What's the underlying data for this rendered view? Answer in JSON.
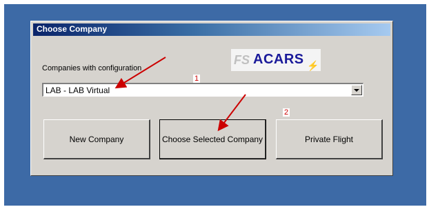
{
  "window": {
    "title": "Choose Company"
  },
  "form": {
    "companies_label": "Companies with configuration",
    "selected_company": "LAB - LAB Virtual"
  },
  "logo": {
    "prefix": "FS",
    "name": "ACARS"
  },
  "buttons": {
    "new_company": "New Company",
    "choose_selected": "Choose Selected Company",
    "private_flight": "Private Flight"
  },
  "annotations": {
    "marker1": "1",
    "marker2": "2"
  },
  "colors": {
    "desktop": "#3d6aa6",
    "dialog": "#d6d3ce",
    "titlebar_start": "#0a246a",
    "annotation_red": "#cc0000",
    "logo_blue": "#1a1a9a"
  },
  "icons": {
    "combo_arrow": "chevron-down-icon",
    "logo_mark": "lightning-icon"
  }
}
